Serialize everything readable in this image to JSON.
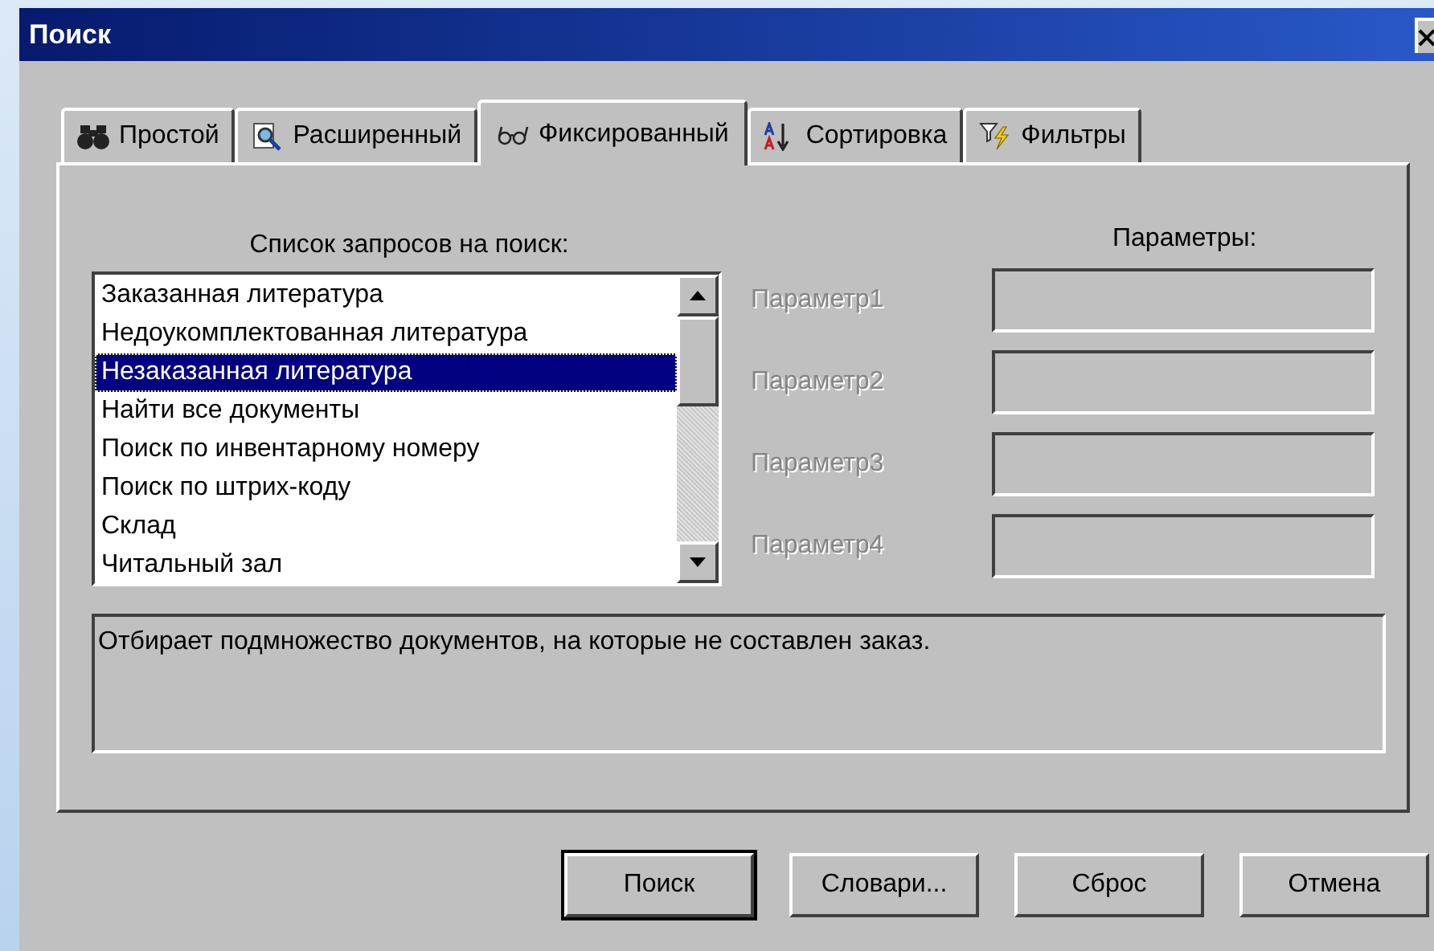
{
  "window": {
    "title": "Поиск"
  },
  "tabs": [
    {
      "label": "Простой",
      "selected": false
    },
    {
      "label": "Расширенный",
      "selected": false
    },
    {
      "label": "Фиксированный",
      "selected": true
    },
    {
      "label": "Сортировка",
      "selected": false
    },
    {
      "label": "Фильтры",
      "selected": false
    }
  ],
  "query_list": {
    "caption": "Список запросов на поиск:",
    "items": [
      {
        "label": "Заказанная литература",
        "selected": false
      },
      {
        "label": "Недоукомплектованная литература",
        "selected": false
      },
      {
        "label": "Незаказанная литература",
        "selected": true
      },
      {
        "label": "Найти все документы",
        "selected": false
      },
      {
        "label": "Поиск по инвентарному номеру",
        "selected": false
      },
      {
        "label": "Поиск по штрих-коду",
        "selected": false
      },
      {
        "label": "Склад",
        "selected": false
      },
      {
        "label": "Читальный зал",
        "selected": false
      }
    ]
  },
  "parameters": {
    "caption": "Параметры:",
    "items": [
      {
        "label": "Параметр1",
        "disabled": true
      },
      {
        "label": "Параметр2",
        "disabled": true
      },
      {
        "label": "Параметр3",
        "disabled": true
      },
      {
        "label": "Параметр4",
        "disabled": true
      }
    ]
  },
  "description": "Отбирает подмножество документов, на которые не составлен заказ.",
  "buttons": [
    {
      "label": "Поиск",
      "default": true
    },
    {
      "label": "Словари...",
      "default": false
    },
    {
      "label": "Сброс",
      "default": false
    },
    {
      "label": "Отмена",
      "default": false
    }
  ]
}
